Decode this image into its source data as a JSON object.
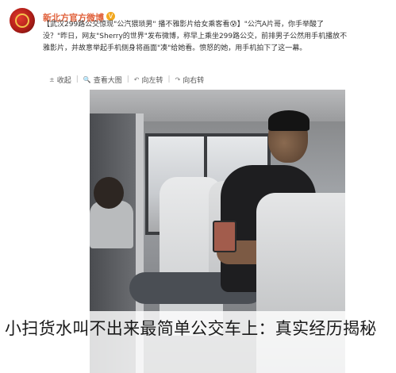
{
  "post": {
    "account_name": "新北方官方微博",
    "verified_mark": "V",
    "text_lines": [
      "【武汉299路公交惊现\"公汽猥琐男\" 播不雅影片给女乘客看😰】\"公汽A片哥，你手举酸了",
      "没？\"昨日，网友\"Sherry的世界\"发布微博，称早上乘坐299路公交，前排男子公然用手机播放不",
      "雅影片，并故意举起手机侧身将画面\"凑\"给她看。愤怒的她，用手机拍下了这一幕。"
    ]
  },
  "toolbar": {
    "collapse_label": "收起",
    "view_large_label": "查看大图",
    "rotate_left_label": "向左转",
    "rotate_right_label": "向右转",
    "collapse_icon": "up-arrow-icon",
    "view_large_icon": "magnifier-icon",
    "rotate_left_icon": "rotate-left-icon",
    "rotate_right_icon": "rotate-right-icon"
  },
  "caption": {
    "text": "小扫货水叫不出来最简单公交车上：真实经历揭秘"
  },
  "colors": {
    "account_name": "#e0603a",
    "verified": "#f2a81f"
  }
}
